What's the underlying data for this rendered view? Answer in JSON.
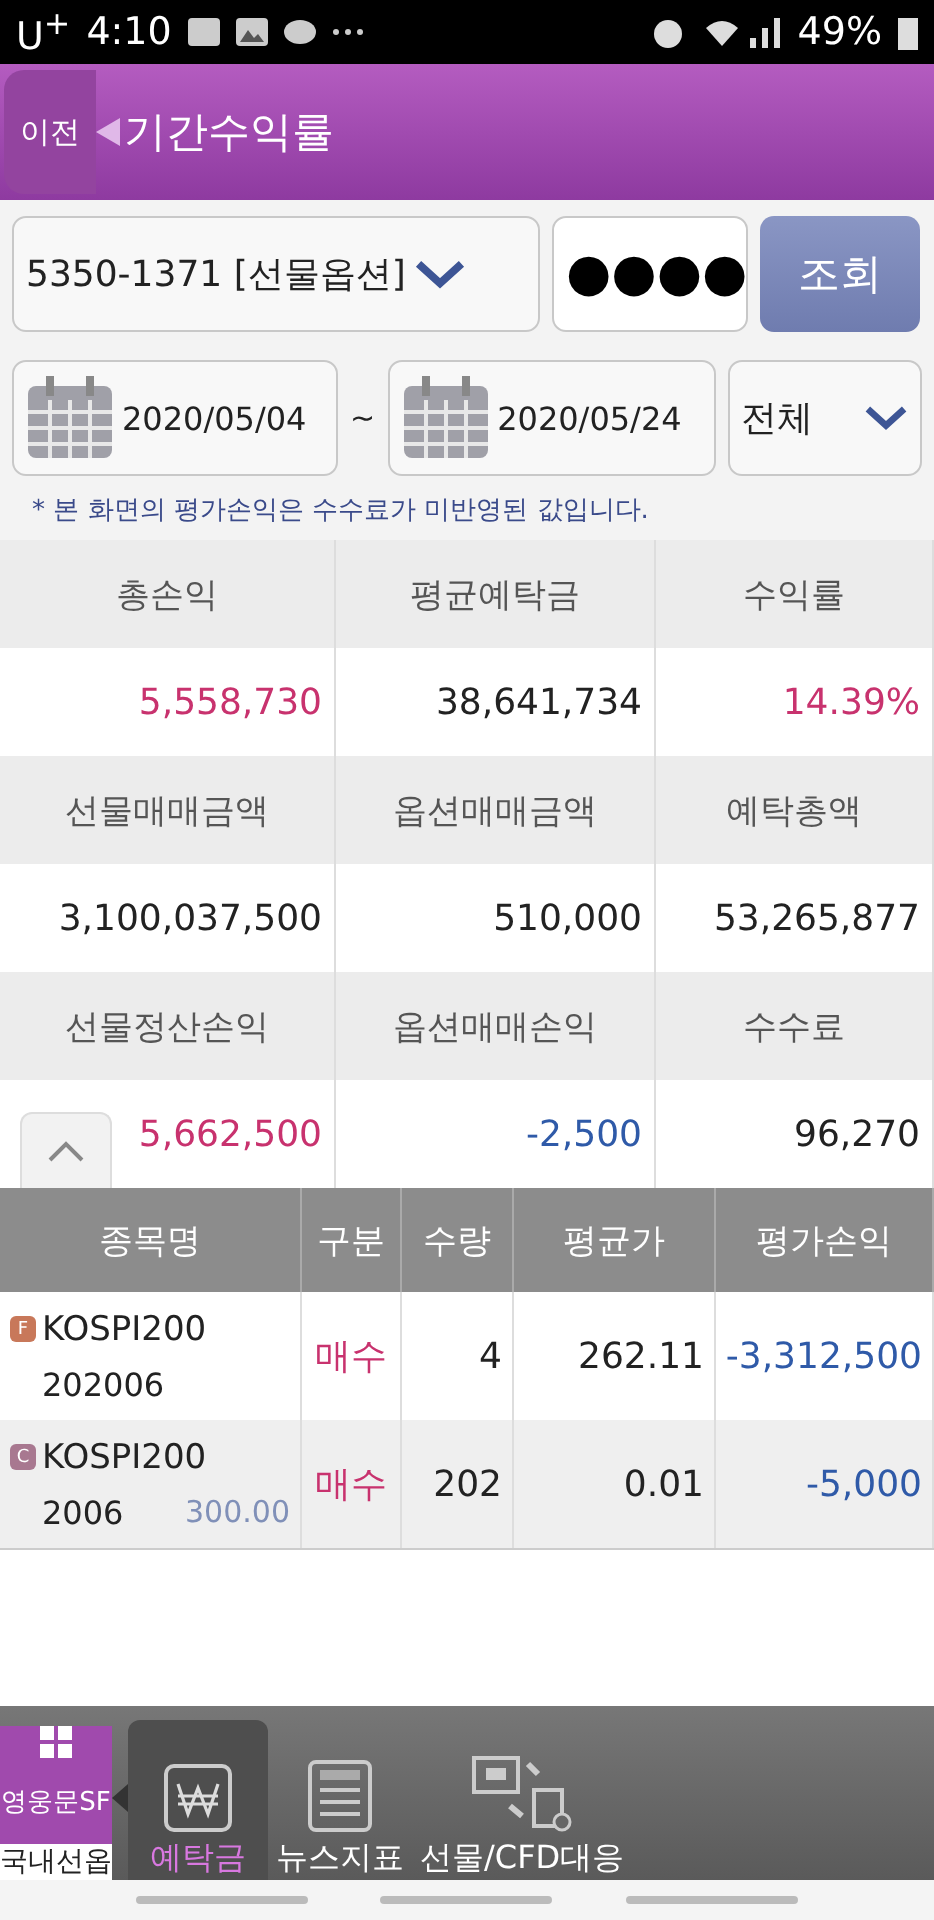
{
  "status_bar": {
    "carrier": "U$^{+}$",
    "time": "4:10",
    "battery": "49%"
  },
  "header": {
    "back": "이전",
    "title": "기간수익률"
  },
  "query": {
    "account": "5350-1371 [선물옵션]",
    "password": "●●●●",
    "submit": "조회"
  },
  "period": {
    "start": "2020/05/04",
    "separator": "~",
    "end": "2020/05/24",
    "filter": "전체"
  },
  "note": "* 본 화면의 평가손익은 수수료가 미반영된 값입니다.",
  "summary": [
    {
      "label": "총손익",
      "value": "5,558,730",
      "color": "#c8326e"
    },
    {
      "label": "평균예탁금",
      "value": "38,641,734",
      "color": "#222222"
    },
    {
      "label": "수익률",
      "value": "14.39%",
      "color": "#c8326e"
    },
    {
      "label": "선물매매금액",
      "value": "3,100,037,500",
      "color": "#222222"
    },
    {
      "label": "옵션매매금액",
      "value": "510,000",
      "color": "#222222"
    },
    {
      "label": "예탁총액",
      "value": "53,265,877",
      "color": "#222222"
    },
    {
      "label": "선물정산손익",
      "value": "5,662,500",
      "color": "#c8326e"
    },
    {
      "label": "옵션매매손익",
      "value": "-2,500",
      "color": "#2f5aa8"
    },
    {
      "label": "수수료",
      "value": "96,270",
      "color": "#222222"
    }
  ],
  "table": {
    "columns": [
      "종목명",
      "구분",
      "수량",
      "평균가",
      "평가손익"
    ],
    "rows": [
      {
        "badge": "F",
        "color": "#c8785a",
        "name": "KOSPI200",
        "code": "202006",
        "strike": "",
        "side": "매수",
        "qty": "4",
        "avg": "262.11",
        "pnl": "-3,312,500"
      },
      {
        "badge": "C",
        "color": "#a87890",
        "name": "KOSPI200",
        "code": "2006",
        "strike": "300.00",
        "side": "매수",
        "qty": "202",
        "avg": "0.01",
        "pnl": "-5,000"
      }
    ]
  },
  "bottom_bar": {
    "app_logo": "영웅문SF",
    "app_label": "국내선옵",
    "items": [
      {
        "label": "예탁금",
        "kind": "won",
        "selected": true
      },
      {
        "label": "뉴스지표",
        "kind": "news",
        "selected": false
      },
      {
        "label": "선물/CFD대응",
        "kind": "transfer",
        "selected": false
      }
    ]
  }
}
